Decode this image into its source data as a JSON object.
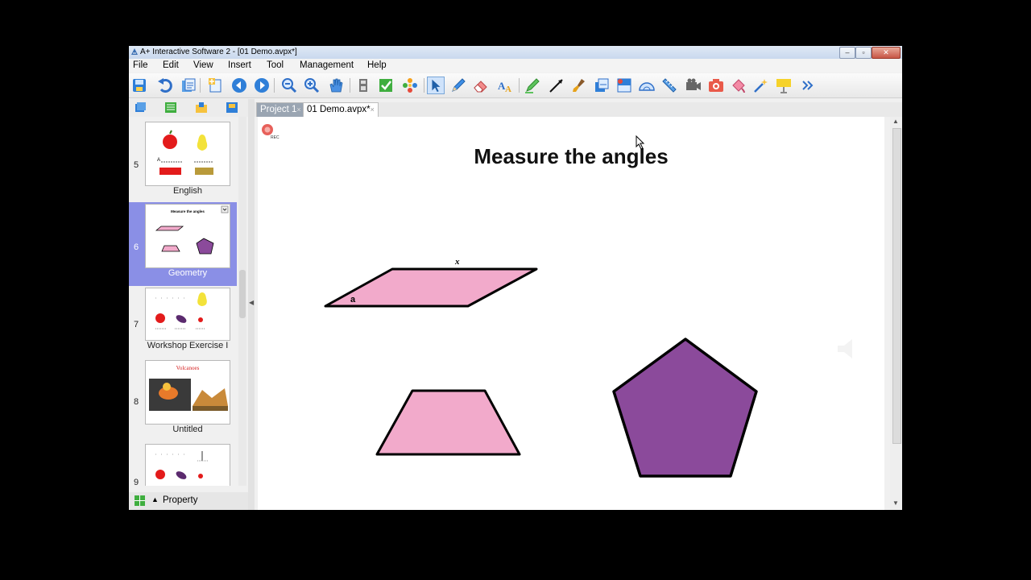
{
  "window": {
    "title": "A+ Interactive Software 2 - [01 Demo.avpx*]",
    "controls": {
      "minimize": "–",
      "restore": "▫",
      "close": "✕"
    }
  },
  "menu": [
    "File",
    "Edit",
    "View",
    "Insert",
    "Tool",
    "Management",
    "Help"
  ],
  "toolbar_icons": [
    "save-icon",
    "undo-icon",
    "clipboard-icon",
    "new-page-icon",
    "previous-page-icon",
    "next-page-icon",
    "zoom-out-icon",
    "zoom-in-icon",
    "pan-hand-icon",
    "page-icon",
    "checkmark-icon",
    "flower-icon",
    "select-arrow-icon",
    "pencil-icon",
    "eraser-icon",
    "text-tool-icon",
    "highlighter-icon",
    "line-icon",
    "brush-icon",
    "screen-capture-icon",
    "screen-shade-icon",
    "protractor-icon",
    "ruler-icon",
    "video-camera-icon",
    "photo-camera-icon",
    "fill-icon",
    "magic-wand-icon",
    "spotlight-icon",
    "more-icon"
  ],
  "doc_tabs": [
    {
      "label": "Project 1",
      "active": false
    },
    {
      "label": "01 Demo.avpx*",
      "active": true
    }
  ],
  "slides": [
    {
      "number": "5",
      "label": "English",
      "selected": false
    },
    {
      "number": "6",
      "label": "Geometry",
      "selected": true
    },
    {
      "number": "7",
      "label": "Workshop Exercise I",
      "selected": false
    },
    {
      "number": "8",
      "label": "Untitled",
      "selected": false
    },
    {
      "number": "9",
      "label": "",
      "selected": false
    }
  ],
  "thumb_texts": {
    "slide5_letter": "A",
    "slide6_title": "Measure the angles",
    "slide8_title": "Volcanoes"
  },
  "property_label": "Property",
  "rec_label": "REC",
  "canvas": {
    "heading": "Measure the angles",
    "label_x": "x",
    "label_a": "a",
    "colors": {
      "pink": "#f2aacb",
      "purple": "#8b4a9b",
      "outline": "#000000"
    }
  }
}
